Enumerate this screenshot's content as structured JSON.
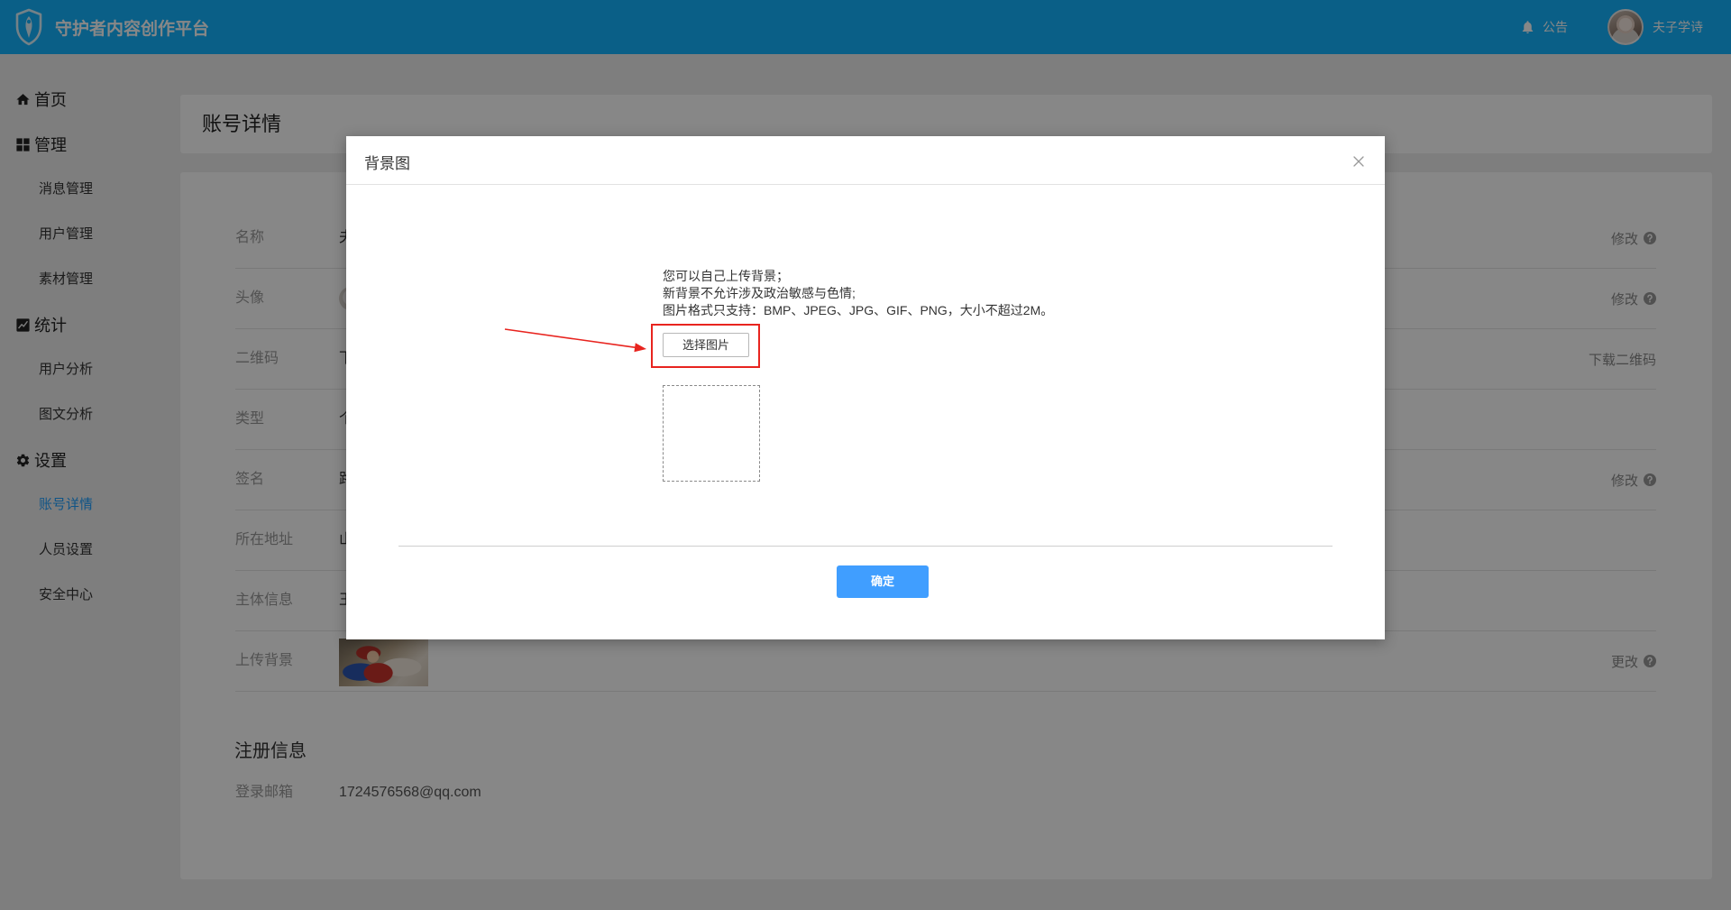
{
  "colors": {
    "header_bg": "#14b4ff",
    "active_nav": "#1e9fff",
    "primary_button": "#409eff",
    "annotation_red": "#e8241f"
  },
  "header": {
    "logo_icon": "shield-icon",
    "title": "守护者内容创作平台",
    "notice_icon": "bell-icon",
    "notice_label": "公告",
    "avatar": "user-avatar",
    "username": "夫子学诗"
  },
  "sidebar": {
    "home": {
      "icon": "home-icon",
      "label": "首页"
    },
    "manage": {
      "icon": "grid-icon",
      "label": "管理",
      "items": [
        {
          "label": "消息管理"
        },
        {
          "label": "用户管理"
        },
        {
          "label": "素材管理"
        }
      ]
    },
    "stats": {
      "icon": "chart-icon",
      "label": "统计",
      "items": [
        {
          "label": "用户分析"
        },
        {
          "label": "图文分析"
        }
      ]
    },
    "settings": {
      "icon": "gear-icon",
      "label": "设置",
      "items": [
        {
          "label": "账号详情",
          "active": true
        },
        {
          "label": "人员设置"
        },
        {
          "label": "安全中心"
        }
      ]
    }
  },
  "page": {
    "title": "账号详情",
    "rows": [
      {
        "label": "名称",
        "value": "夫",
        "action": "修改",
        "action_icon": "help-icon"
      },
      {
        "label": "头像",
        "value_icon": "avatar-thumbnail",
        "action": "修改",
        "action_icon": "help-icon"
      },
      {
        "label": "二维码",
        "value": "下",
        "action": "下载二维码"
      },
      {
        "label": "类型",
        "value": "个"
      },
      {
        "label": "签名",
        "value": "路",
        "action": "修改",
        "action_icon": "help-icon"
      },
      {
        "label": "所在地址",
        "value": "山"
      },
      {
        "label": "主体信息",
        "value": "王"
      },
      {
        "label": "上传背景",
        "value_icon": "background-thumbnail",
        "action": "更改",
        "action_icon": "help-icon"
      }
    ],
    "registration": {
      "title": "注册信息",
      "email_label": "登录邮箱",
      "email_value": "1724576568@qq.com"
    }
  },
  "modal": {
    "title": "背景图",
    "close_icon": "close-icon",
    "tips": [
      "您可以自己上传背景；",
      "新背景不允许涉及政治敏感与色情;",
      "图片格式只支持：BMP、JPEG、JPG、GIF、PNG，大小不超过2M。"
    ],
    "select_button": "选择图片",
    "annotation_icon": "red-arrow-icon",
    "confirm_button": "确定"
  }
}
